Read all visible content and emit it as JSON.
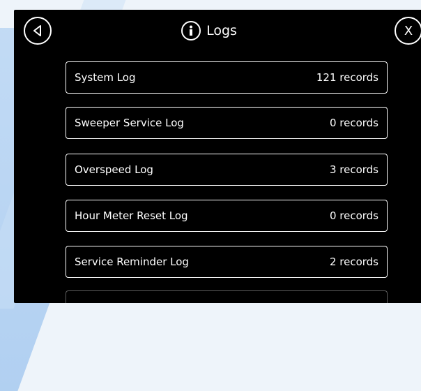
{
  "header": {
    "title": "Logs",
    "close_label": "X"
  },
  "logs": [
    {
      "name": "System Log",
      "count": "121 records"
    },
    {
      "name": "Sweeper Service Log",
      "count": "0 records"
    },
    {
      "name": "Overspeed Log",
      "count": "3 records"
    },
    {
      "name": "Hour Meter Reset Log",
      "count": "0 records"
    },
    {
      "name": "Service Reminder Log",
      "count": "2 records"
    }
  ],
  "icons": {
    "back": "back-arrow-icon",
    "info": "info-icon",
    "close": "close-icon"
  },
  "colors": {
    "screen_background": "#000000",
    "foreground": "#ffffff"
  }
}
